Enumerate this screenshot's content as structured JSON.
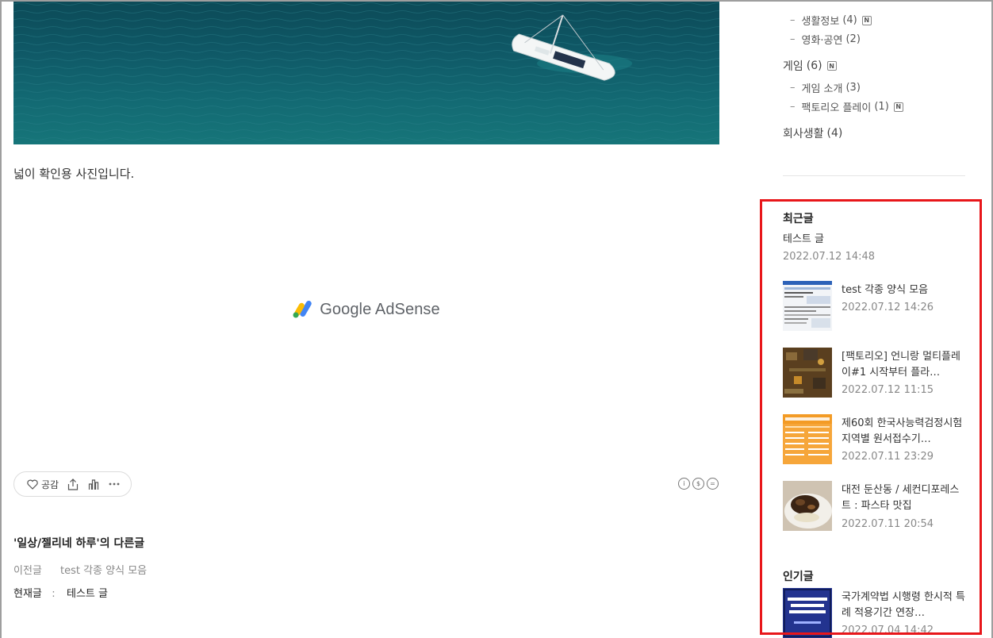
{
  "main": {
    "caption": "넓이 확인용 사진입니다.",
    "ad_brand": "Google AdSense",
    "reaction": {
      "like_label": "공감"
    },
    "related": {
      "title": "'일상/젤리네 하루'의 다른글",
      "prev_label": "이전글",
      "prev_title": "test 각종 양식 모음",
      "current_label": "현재글",
      "current_sep": ":",
      "current_title": "테스트 글"
    }
  },
  "sidebar": {
    "categories": [
      {
        "name": "생활정보",
        "count": "(4)",
        "new": true,
        "level": "sub"
      },
      {
        "name": "영화·공연",
        "count": "(2)",
        "new": false,
        "level": "sub"
      },
      {
        "name": "게임",
        "count": "(6)",
        "new": true,
        "level": "top"
      },
      {
        "name": "게임 소개",
        "count": "(3)",
        "new": false,
        "level": "sub"
      },
      {
        "name": "팩토리오 플레이",
        "count": "(1)",
        "new": true,
        "level": "sub"
      },
      {
        "name": "회사생활",
        "count": "(4)",
        "new": false,
        "level": "top"
      }
    ],
    "new_badge": "N",
    "recent": {
      "title": "최근글",
      "posts": [
        {
          "title": "테스트 글",
          "date": "2022.07.12 14:48"
        },
        {
          "title": "test 각종 양식 모음",
          "date": "2022.07.12 14:26"
        },
        {
          "title": "[팩토리오] 언니랑 멀티플레이#1 시작부터 플라…",
          "date": "2022.07.12 11:15"
        },
        {
          "title": "제60회 한국사능력검정시험 지역별 원서접수기…",
          "date": "2022.07.11 23:29"
        },
        {
          "title": "대전 둔산동 / 세컨디포레스트 : 파스타 맛집",
          "date": "2022.07.11 20:54"
        }
      ]
    },
    "popular": {
      "title": "인기글",
      "posts": [
        {
          "title": "국가계약법 시행령 한시적 특례 적용기간 연장…",
          "date": "2022.07.04 14:42"
        }
      ]
    }
  },
  "colors": {
    "highlight_border": "#e8161a",
    "text_muted": "#888888"
  }
}
